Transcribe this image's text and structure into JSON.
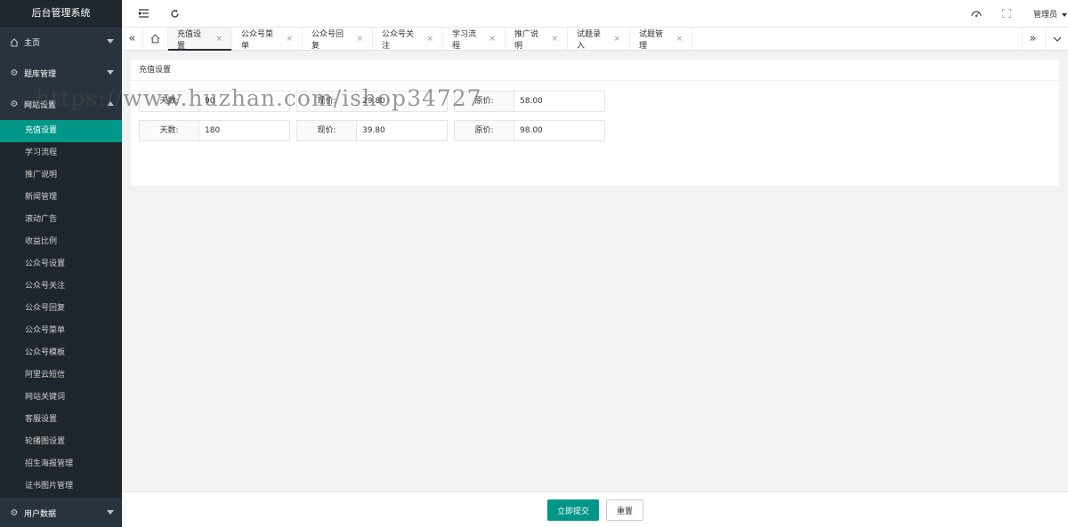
{
  "app": {
    "title": "后台管理系统"
  },
  "sidebar": {
    "groups": [
      {
        "label": "主页",
        "icon": "home-icon"
      },
      {
        "label": "题库管理",
        "icon": "gear-icon"
      },
      {
        "label": "网站设置",
        "icon": "gear-icon"
      }
    ],
    "sub_items": [
      "充值设置",
      "学习流程",
      "推广说明",
      "新闻管理",
      "滚动广告",
      "收益比例",
      "公众号设置",
      "公众号关注",
      "公众号回复",
      "公众号菜单",
      "公众号模板",
      "阿里云短信",
      "网站关键词",
      "客服设置",
      "轮播图设置",
      "招生海报管理",
      "证书图片管理"
    ],
    "bottom_group": {
      "label": "用户数据",
      "icon": "gear-icon"
    }
  },
  "header": {
    "user": "管理员"
  },
  "tabs": [
    "充值设置",
    "公众号菜单",
    "公众号回复",
    "公众号关注",
    "学习流程",
    "推广说明",
    "试题录入",
    "试题管理"
  ],
  "card": {
    "title": "充值设置",
    "rows": [
      {
        "days_label": "天数:",
        "days": "90",
        "price_label": "现价:",
        "price": "29.80",
        "orig_label": "原价:",
        "orig": "58.00"
      },
      {
        "days_label": "天数:",
        "days": "180",
        "price_label": "现价:",
        "price": "39.80",
        "orig_label": "原价:",
        "orig": "98.00"
      }
    ]
  },
  "watermark": "https://www.huzhan.com/ishop34727",
  "footer": {
    "submit": "立即提交",
    "reset": "重置"
  },
  "colors": {
    "sidebar": "#28333e",
    "accent": "#009688"
  }
}
